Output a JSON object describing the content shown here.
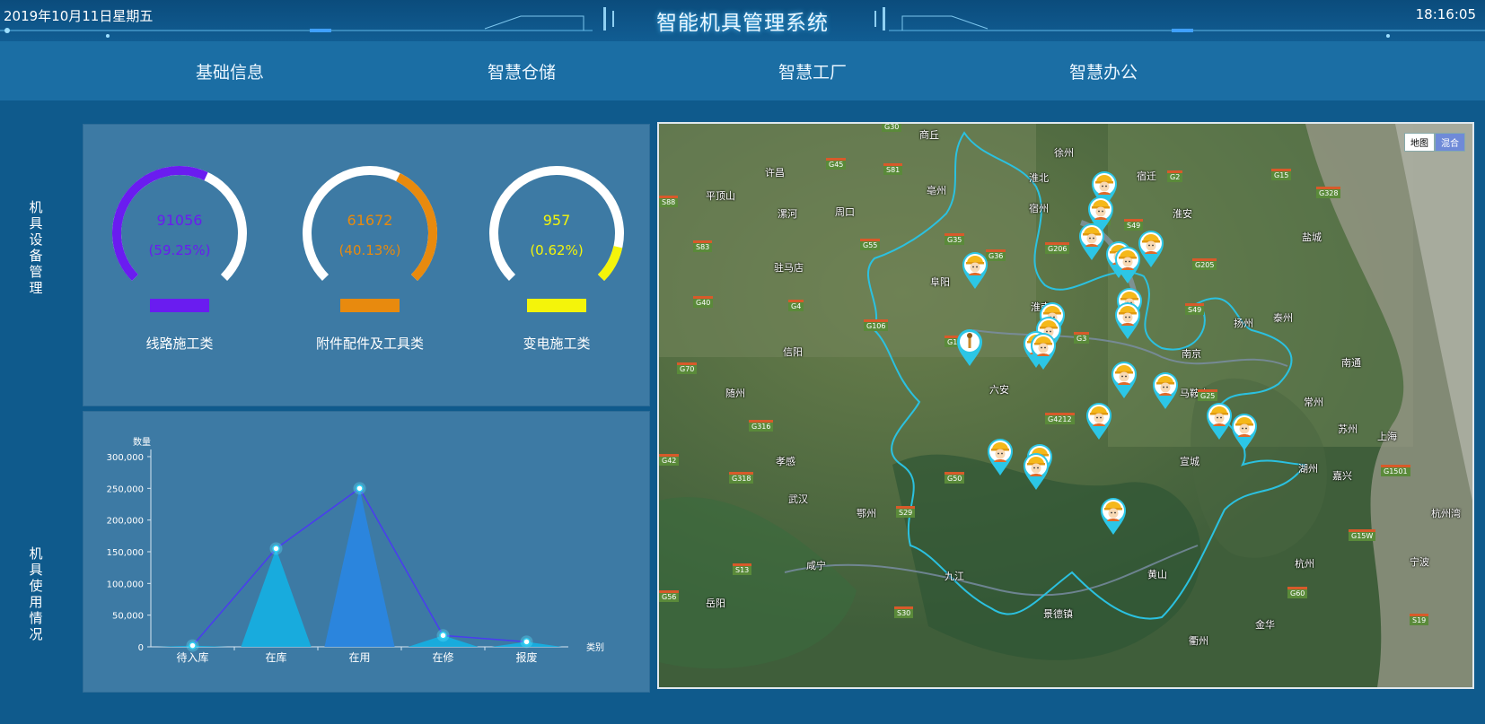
{
  "header": {
    "date": "2019年10月11日星期五",
    "title": "智能机具管理系统",
    "time": "18:16:05"
  },
  "nav": {
    "items": [
      {
        "label": "基础信息"
      },
      {
        "label": "智慧仓储"
      },
      {
        "label": "智慧工厂"
      },
      {
        "label": "智慧办公"
      }
    ]
  },
  "sections": {
    "equipment": "机具设备管理",
    "usage": "机具使用情况"
  },
  "gauges": [
    {
      "value": "91056",
      "percent": "(59.25%)",
      "fraction": 0.5925,
      "name": "线路施工类",
      "color": "#6a1cf0"
    },
    {
      "value": "61672",
      "percent": "(40.13%)",
      "fraction": 0.4013,
      "name": "附件配件及工具类",
      "color": "#e88a0e"
    },
    {
      "value": "957",
      "percent": "(0.62%)",
      "fraction": 0.0062,
      "name": "变电施工类",
      "color": "#f4f40a"
    }
  ],
  "chart_data": {
    "type": "line",
    "ylabel": "数量",
    "xlabel": "类别",
    "categories": [
      "待入库",
      "在库",
      "在用",
      "在修",
      "报废"
    ],
    "values": [
      2000,
      155000,
      250000,
      18000,
      8000
    ],
    "ylim": [
      0,
      300000
    ],
    "yticks": [
      "0",
      "50,000",
      "100,000",
      "150,000",
      "200,000",
      "250,000",
      "300,000"
    ],
    "line_color": "#4a3cf0",
    "area_colors": [
      "#16aee0",
      "#16aee0",
      "#2a86e0",
      "#16aee0",
      "#16aee0"
    ]
  },
  "map": {
    "controls": [
      "地图",
      "混合"
    ],
    "cities": [
      "商丘",
      "许昌",
      "平顶山",
      "漯河",
      "周口",
      "亳州",
      "淮北",
      "徐州",
      "宿迁",
      "淮安",
      "盐城",
      "驻马店",
      "阜阳",
      "宿州",
      "淮南",
      "扬州",
      "泰州",
      "信阳",
      "六安",
      "南京",
      "常州",
      "南通",
      "随州",
      "马鞍山",
      "苏州",
      "上海",
      "宣城",
      "湖州",
      "嘉兴",
      "孝感",
      "武汉",
      "鄂州",
      "咸宁",
      "九江",
      "黄山",
      "杭州",
      "宁波",
      "岳阳",
      "景德镇",
      "衢州",
      "金华",
      "杭州湾"
    ],
    "roads": [
      "G30",
      "G45",
      "S81",
      "G15",
      "G328",
      "G2",
      "S04",
      "S49",
      "G205",
      "G206",
      "G36",
      "G35",
      "G55",
      "S83",
      "G4",
      "G40",
      "G106",
      "G105",
      "G3",
      "G25",
      "G4212",
      "G70",
      "G316",
      "G42",
      "G318",
      "G50",
      "S29",
      "S13",
      "S30",
      "G60",
      "S19",
      "G1501",
      "G15W",
      "G56",
      "S88",
      "S49"
    ]
  }
}
